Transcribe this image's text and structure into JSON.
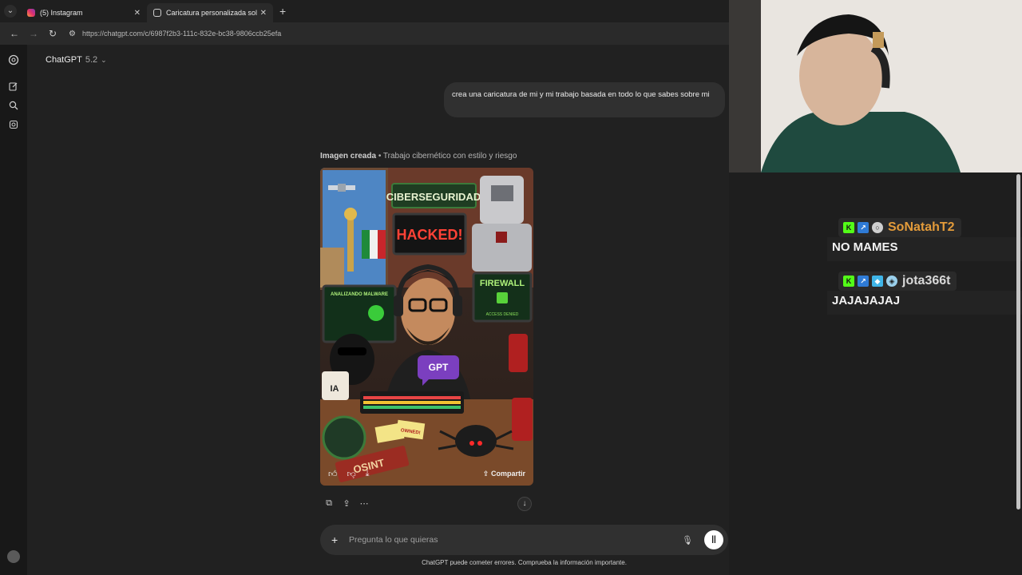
{
  "browser": {
    "tabs": [
      {
        "title": "(5) Instagram",
        "icon": "instagram-icon",
        "active": false
      },
      {
        "title": "Caricatura personalizada solicit",
        "icon": "chatgpt-icon",
        "active": true
      }
    ],
    "url": "https://chatgpt.com/c/6987f2b3-111c-832e-bc38-9806ccb25efa"
  },
  "chat": {
    "model_name": "ChatGPT",
    "model_version": "5.2",
    "user_message": "crea una caricatura de mi y mi trabajo basada en todo lo que sabes sobre mi",
    "image_caption_bold": "Imagen creada",
    "image_caption_rest": " • Trabajo cibernético con estilo y riesgo",
    "image_share_label": "Compartir",
    "image_texts": {
      "ciberseguridad": "CIBERSEGURIDAD",
      "hacked": "HACKED!",
      "firewall": "FIREWALL",
      "access": "ACCESS DENIED",
      "malware": "ANALIZANDO MALWARE",
      "gpt": "GPT",
      "mug": "IA",
      "osint": "OSINT",
      "owned": "OWNED!"
    },
    "composer_placeholder": "Pregunta lo que quieras",
    "disclaimer": "ChatGPT puede cometer errores. Comprueba la información importante."
  },
  "stream_chat": {
    "messages": [
      {
        "user": "SoNatahT2",
        "user_color": "#e39b3a",
        "badges": [
          "kick-icon",
          "boost-icon",
          "ring-icon"
        ],
        "text": "NO MAMES"
      },
      {
        "user": "jota366t",
        "user_color": "#d8d8d8",
        "badges": [
          "kick-icon",
          "boost-icon",
          "cube-icon",
          "gem-icon"
        ],
        "text": "JAJAJAJAJ"
      }
    ]
  }
}
